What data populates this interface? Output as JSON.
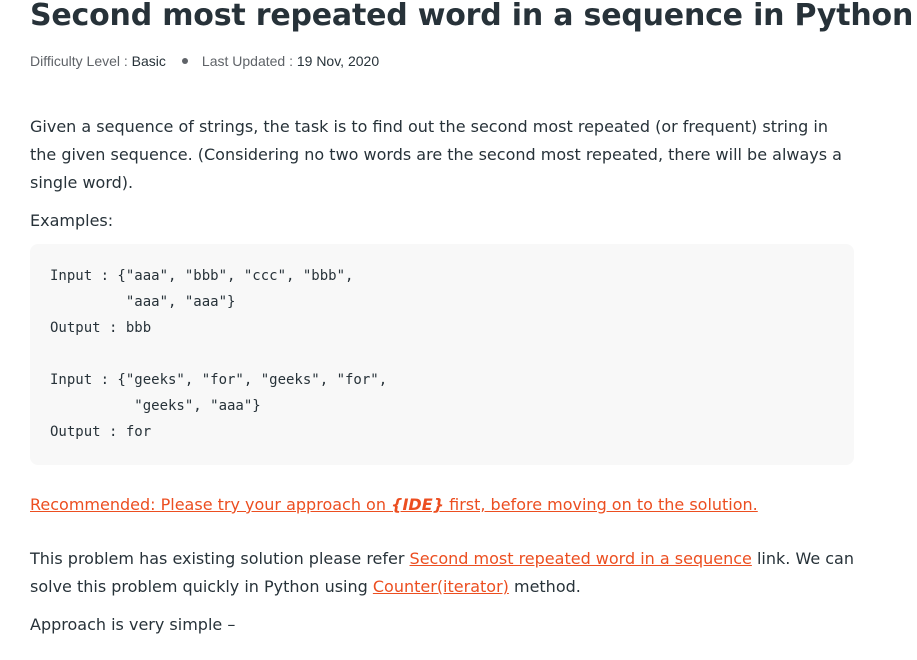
{
  "article": {
    "title": "Second most repeated word in a sequence in Python",
    "meta": {
      "difficulty_label": "Difficulty Level : ",
      "difficulty_value": "Basic",
      "updated_label": "Last Updated : ",
      "updated_value": "19 Nov, 2020"
    },
    "intro": "Given a sequence of strings, the task is to find out the second most repeated (or frequent) string in the given sequence. (Considering no two words are the second most repeated, there will be always a single word).",
    "examples_label": "Examples:",
    "code": "Input : {\"aaa\", \"bbb\", \"ccc\", \"bbb\",\n         \"aaa\", \"aaa\"}\nOutput : bbb\n\nInput : {\"geeks\", \"for\", \"geeks\", \"for\",\n          \"geeks\", \"aaa\"}\nOutput : for",
    "recommended": {
      "prefix": "Recommended: Please try your approach on ",
      "ide": "{IDE}",
      "suffix": " first, before moving on to the solution."
    },
    "solution": {
      "text1": "This problem has existing solution please refer ",
      "link1": "Second most repeated word in a sequence",
      "text2": " link. We can solve this problem quickly in Python using ",
      "link2": "Counter(iterator)",
      "text3": " method."
    },
    "approach": "Approach is very simple –"
  },
  "colors": {
    "text": "#273239",
    "link": "#ec4e20",
    "code_bg": "#f8f8f8"
  }
}
